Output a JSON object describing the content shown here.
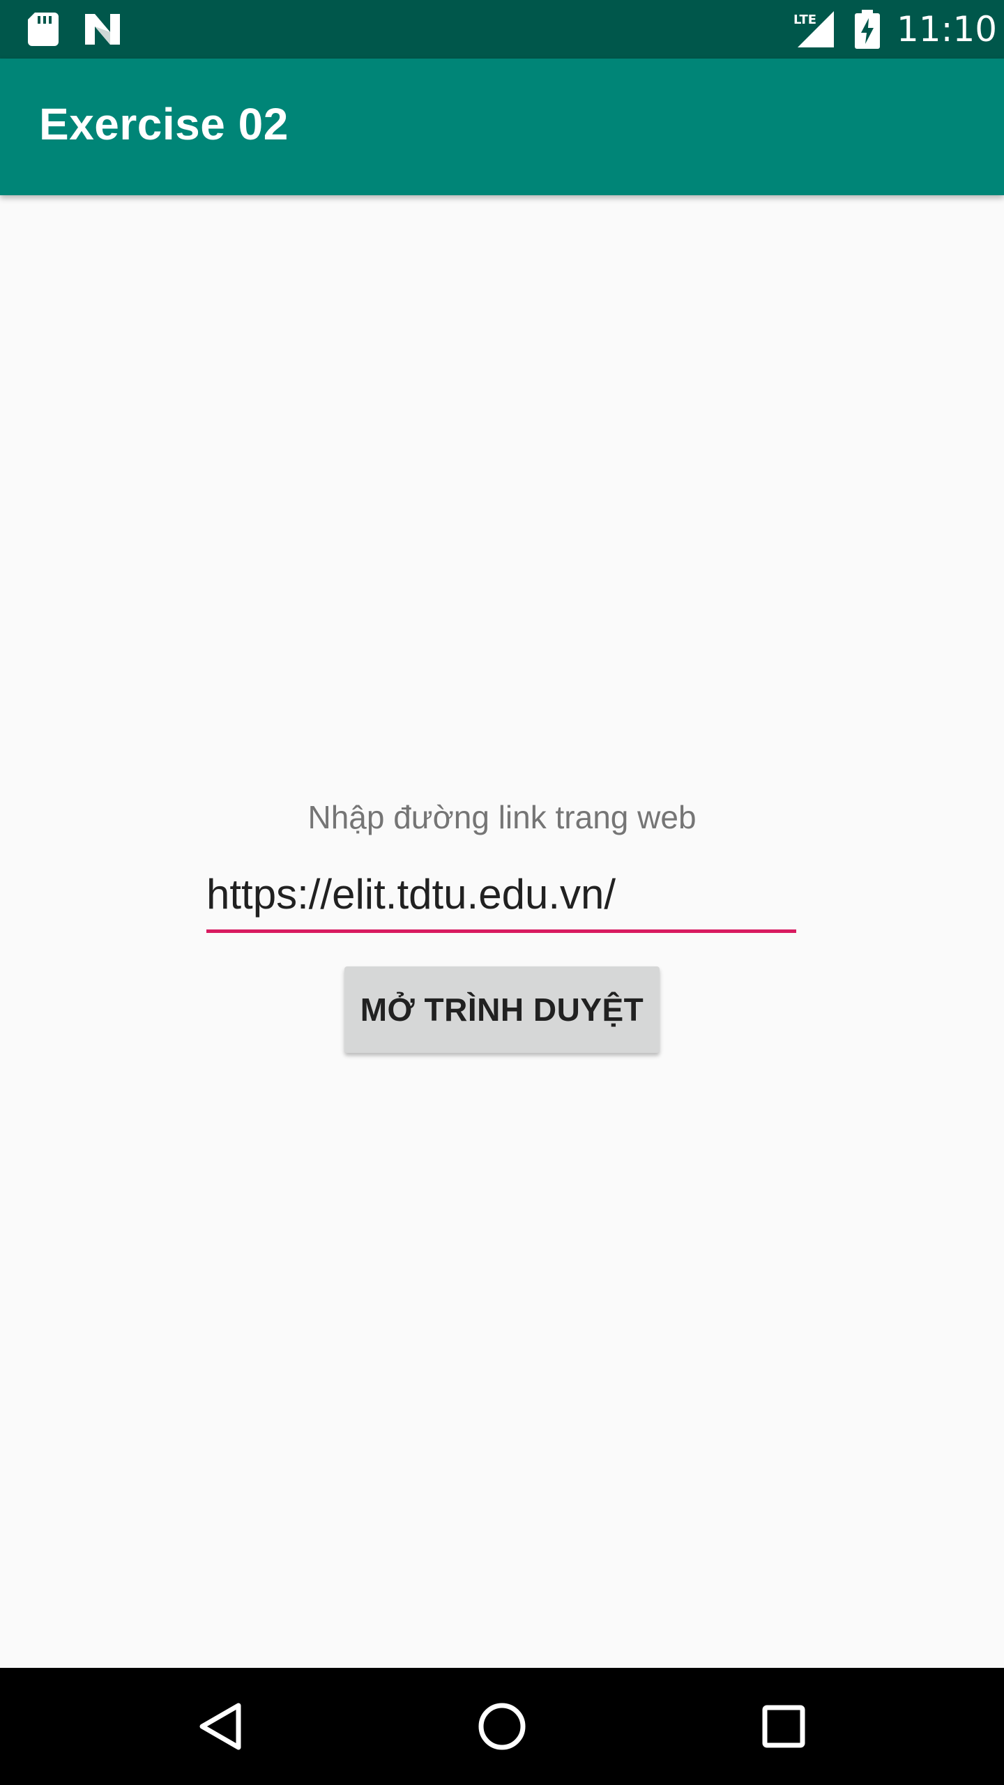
{
  "status_bar": {
    "time": "11:10",
    "network_label": "LTE",
    "icons": [
      "sd-card-icon",
      "n-notification-icon",
      "lte-signal-icon",
      "battery-charging-icon"
    ]
  },
  "app_bar": {
    "title": "Exercise 02"
  },
  "main": {
    "prompt_label": "Nhập đường link trang web",
    "url_input": {
      "value": "https://elit.tdtu.edu.vn/",
      "placeholder": ""
    },
    "open_button_label": "MỞ TRÌNH DUYỆT"
  },
  "nav_bar": {
    "buttons": [
      "back-icon",
      "home-icon",
      "recents-icon"
    ]
  },
  "colors": {
    "status_bar": "#00574b",
    "app_bar": "#008577",
    "accent_underline": "#d81b60",
    "button_bg": "#d6d7d7",
    "background": "#fafafa",
    "nav_bar": "#000000"
  }
}
